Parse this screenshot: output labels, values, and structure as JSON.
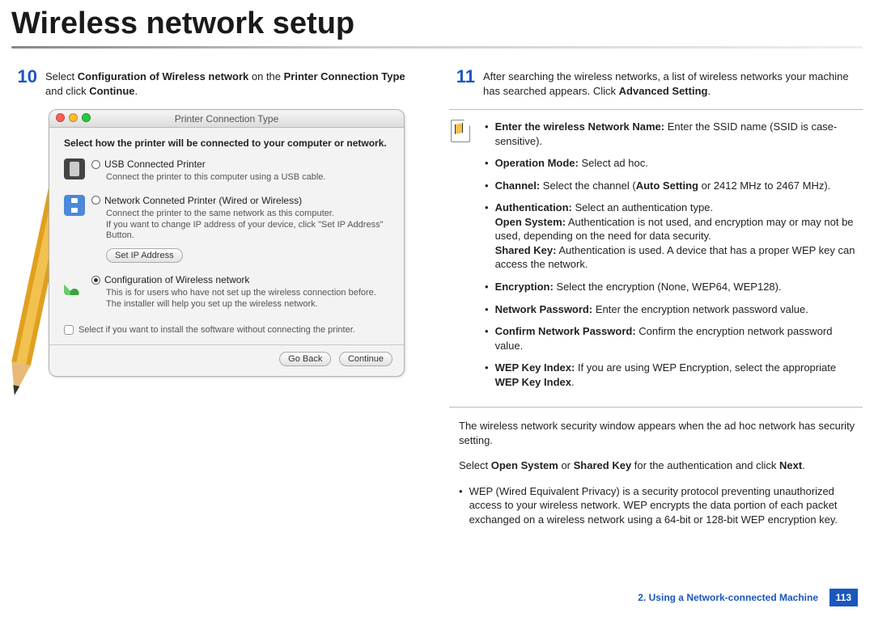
{
  "title": "Wireless network setup",
  "step10": {
    "num": "10",
    "text_pre": "Select ",
    "b1": "Configuration of Wireless network",
    "mid": " on the ",
    "b2": "Printer Connection Type",
    "post": " and click ",
    "b3": "Continue",
    "tail": "."
  },
  "dialog": {
    "title": "Printer Connection Type",
    "heading": "Select how the printer will be connected to your computer or network.",
    "opt1_label": "USB Connected Printer",
    "opt1_desc": "Connect the printer to this computer using a USB cable.",
    "opt2_label": "Network Conneted Printer (Wired or Wireless)",
    "opt2_desc": "Connect the printer to the same network as this computer.\nIf you want to change IP address of your device, click \"Set IP Address\" Button.",
    "set_ip": "Set IP Address",
    "opt3_label": "Configuration of Wireless network",
    "opt3_desc": "This is for users who have not set up the wireless connection before. The installer will help you set up the wireless network.",
    "checkbox": "Select if you want to install the software without connecting the printer.",
    "goback": "Go Back",
    "continue": "Continue"
  },
  "step11": {
    "num": "11",
    "text": "After searching the wireless networks, a list of wireless networks your machine has searched appears. Click ",
    "b1": "Advanced Setting",
    "tail": "."
  },
  "callout": [
    {
      "b": "Enter the wireless Network Name:",
      "t": " Enter the SSID name (SSID is case-sensitive)."
    },
    {
      "b": "Operation Mode:",
      "t": " Select ad hoc."
    },
    {
      "b": "Channel:",
      "t": " Select the channel (",
      "b2": "Auto Setting",
      "t2": " or 2412 MHz to 2467 MHz)."
    },
    {
      "b": "Authentication:",
      "t": " Select an authentication type.",
      "lines": [
        {
          "b": "Open System:",
          "t": " Authentication is not used, and encryption may or may not be used, depending on the need for data security."
        },
        {
          "b": "Shared Key:",
          "t": " Authentication is used. A device that has a proper WEP key can access the network."
        }
      ]
    },
    {
      "b": "Encryption:",
      "t": " Select the encryption (None, WEP64, WEP128)."
    },
    {
      "b": "Network Password:",
      "t": " Enter the encryption network password value."
    },
    {
      "b": "Confirm Network Password:",
      "t": " Confirm the encryption network password value."
    },
    {
      "b": "WEP Key Index:",
      "t": " If you are using WEP Encryption, select the appropriate ",
      "b2": "WEP Key Index",
      "t2": "."
    }
  ],
  "para1": "The wireless network security window appears when the ad hoc network has security setting.",
  "para2_pre": "Select ",
  "para2_b1": "Open System",
  "para2_mid": " or ",
  "para2_b2": "Shared Key",
  "para2_post": " for the authentication and click ",
  "para2_b3": "Next",
  "para2_tail": ".",
  "bullet_wep": "WEP (Wired Equivalent Privacy) is a security protocol preventing unauthorized access to your wireless network. WEP encrypts the data portion of each packet exchanged on a wireless network using a 64-bit or 128-bit WEP encryption key.",
  "footer_text": "2.  Using a Network-connected Machine",
  "footer_page": "113"
}
